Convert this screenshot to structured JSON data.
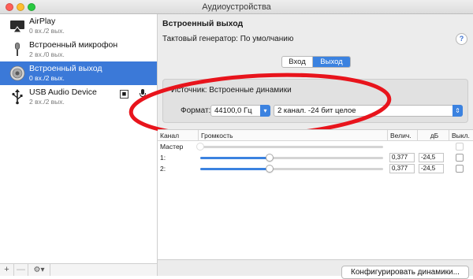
{
  "window": {
    "title": "Аудиоустройства"
  },
  "sidebar": {
    "devices": [
      {
        "name": "AirPlay",
        "sub": "0 вх./2 вых.",
        "icon": "airplay-icon"
      },
      {
        "name": "Встроенный микрофон",
        "sub": "2 вх./0 вых.",
        "icon": "microphone-icon"
      },
      {
        "name": "Встроенный выход",
        "sub": "0 вх./2 вых.",
        "icon": "speaker-icon",
        "selected": true
      },
      {
        "name": "USB Audio Device",
        "sub": "2 вх./2 вых.",
        "icon": "usb-icon"
      }
    ],
    "footer": {
      "add": "+",
      "remove": "—",
      "gear": "⚙▾"
    }
  },
  "main": {
    "title": "Встроенный выход",
    "clock_source": "Тактовый генератор:  По умолчанию",
    "help": "?",
    "tabs": {
      "input": "Вход",
      "output": "Выход",
      "selected": "output"
    },
    "source": "Источник:  Встроенные динамики",
    "format_label": "Формат:",
    "sample_rate": "44100,0 Гц",
    "channel_format": "2 канал. -24 бит целое",
    "table": {
      "headers": {
        "channel": "Канал",
        "volume": "Громкость",
        "value": "Велич.",
        "db": "дБ",
        "mute": "Выкл."
      },
      "rows": [
        {
          "channel": "Мастер",
          "level": 0.0,
          "value": "",
          "db": "",
          "enabled": false
        },
        {
          "channel": "1:",
          "level": 0.38,
          "value": "0,377",
          "db": "-24,5",
          "enabled": true
        },
        {
          "channel": "2:",
          "level": 0.38,
          "value": "0,377",
          "db": "-24,5",
          "enabled": true
        }
      ]
    },
    "configure_button": "Конфигурировать динамики..."
  },
  "colors": {
    "accent": "#3b82e0",
    "selection": "#3b79d8",
    "annotation": "#e8141c"
  }
}
